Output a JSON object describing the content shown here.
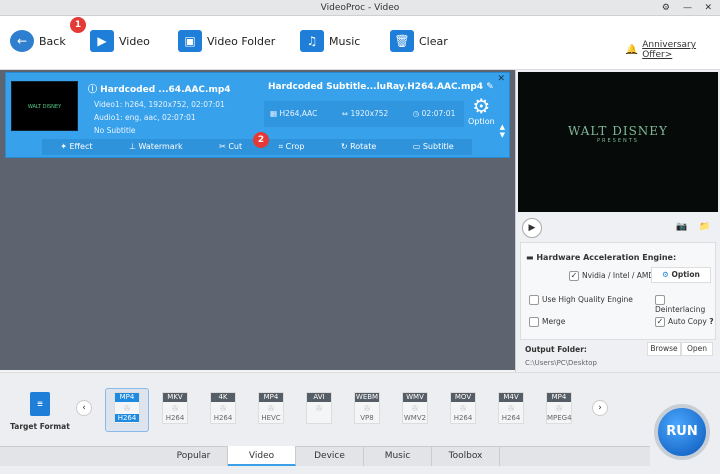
{
  "title": "VideoProc - Video",
  "toolbar": {
    "back": "Back",
    "video": "Video",
    "video_folder": "Video Folder",
    "music": "Music",
    "clear": "Clear",
    "offer": "Anniversary Offer>",
    "badge1": "1",
    "badge2": "2"
  },
  "item": {
    "source_name": "Hardcoded ...64.AAC.mp4",
    "video_track": "Video1: h264, 1920x752, 02:07:01",
    "audio_track": "Audio1: eng, aac, 02:07:01",
    "subtitle": "No Subtitle",
    "output_name": "Hardcoded Subtitle...luRay.H264.AAC.mp4",
    "codec": "H264,AAC",
    "resolution": "1920x752",
    "duration": "02:07:01",
    "option": "Option",
    "thumb_text": "WALT DISNEY"
  },
  "edit_tools": [
    "Effect",
    "Watermark",
    "Cut",
    "Crop",
    "Rotate",
    "Subtitle"
  ],
  "preview": {
    "title": "WALT DISNEY",
    "subtitle": "PRESENTS"
  },
  "hw": {
    "title": "Hardware Acceleration Engine:",
    "nvidia": "Nvidia / Intel / AMD",
    "option": "Option",
    "high_quality": "Use High Quality Engine",
    "deinterlacing": "Deinterlacing",
    "merge": "Merge",
    "auto_copy": "Auto Copy",
    "help": "?"
  },
  "output": {
    "label": "Output Folder:",
    "path": "C:\\Users\\PC\\Desktop",
    "browse": "Browse",
    "open": "Open"
  },
  "target_format": "Target Format",
  "formats": [
    {
      "tag": "MP4",
      "sub": "H264"
    },
    {
      "tag": "MKV",
      "sub": "H264"
    },
    {
      "tag": "4K",
      "sub": "H264"
    },
    {
      "tag": "MP4",
      "sub": "HEVC"
    },
    {
      "tag": "AVI",
      "sub": ""
    },
    {
      "tag": "WEBM",
      "sub": "VP8"
    },
    {
      "tag": "WMV",
      "sub": "WMV2"
    },
    {
      "tag": "MOV",
      "sub": "H264"
    },
    {
      "tag": "M4V",
      "sub": "H264"
    },
    {
      "tag": "MP4",
      "sub": "MPEG4"
    }
  ],
  "tabs": [
    "Popular",
    "Video",
    "Device",
    "Music",
    "Toolbox"
  ],
  "run": "RUN"
}
